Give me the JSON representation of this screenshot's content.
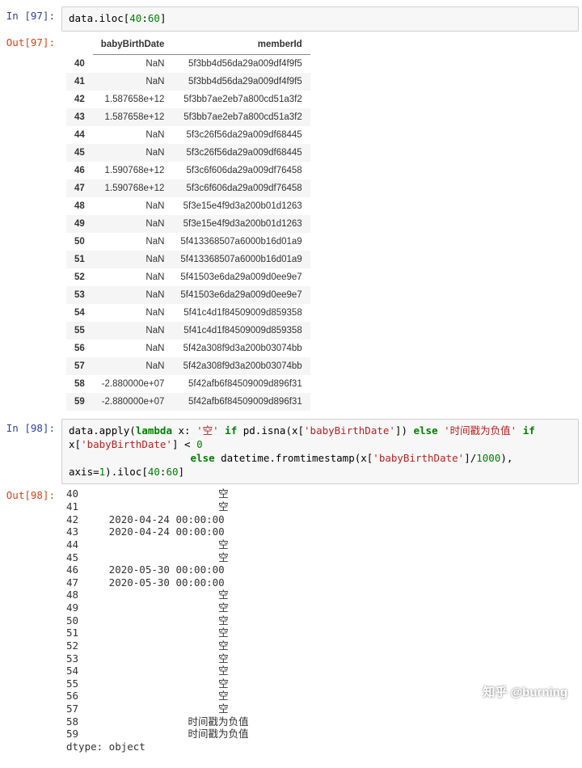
{
  "watermark": "知乎 @burning",
  "cell97": {
    "prompt_in": "In  [97]:",
    "prompt_out": "Out[97]:",
    "code": {
      "obj": "data",
      "method": "iloc",
      "slice": "[40:60]"
    },
    "df": {
      "columns": [
        "babyBirthDate",
        "memberId"
      ],
      "rows": [
        {
          "idx": "40",
          "babyBirthDate": "NaN",
          "memberId": "5f3bb4d56da29a009df4f9f5"
        },
        {
          "idx": "41",
          "babyBirthDate": "NaN",
          "memberId": "5f3bb4d56da29a009df4f9f5"
        },
        {
          "idx": "42",
          "babyBirthDate": "1.587658e+12",
          "memberId": "5f3bb7ae2eb7a800cd51a3f2"
        },
        {
          "idx": "43",
          "babyBirthDate": "1.587658e+12",
          "memberId": "5f3bb7ae2eb7a800cd51a3f2"
        },
        {
          "idx": "44",
          "babyBirthDate": "NaN",
          "memberId": "5f3c26f56da29a009df68445"
        },
        {
          "idx": "45",
          "babyBirthDate": "NaN",
          "memberId": "5f3c26f56da29a009df68445"
        },
        {
          "idx": "46",
          "babyBirthDate": "1.590768e+12",
          "memberId": "5f3c6f606da29a009df76458"
        },
        {
          "idx": "47",
          "babyBirthDate": "1.590768e+12",
          "memberId": "5f3c6f606da29a009df76458"
        },
        {
          "idx": "48",
          "babyBirthDate": "NaN",
          "memberId": "5f3e15e4f9d3a200b01d1263"
        },
        {
          "idx": "49",
          "babyBirthDate": "NaN",
          "memberId": "5f3e15e4f9d3a200b01d1263"
        },
        {
          "idx": "50",
          "babyBirthDate": "NaN",
          "memberId": "5f413368507a6000b16d01a9"
        },
        {
          "idx": "51",
          "babyBirthDate": "NaN",
          "memberId": "5f413368507a6000b16d01a9"
        },
        {
          "idx": "52",
          "babyBirthDate": "NaN",
          "memberId": "5f41503e6da29a009d0ee9e7"
        },
        {
          "idx": "53",
          "babyBirthDate": "NaN",
          "memberId": "5f41503e6da29a009d0ee9e7"
        },
        {
          "idx": "54",
          "babyBirthDate": "NaN",
          "memberId": "5f41c4d1f84509009d859358"
        },
        {
          "idx": "55",
          "babyBirthDate": "NaN",
          "memberId": "5f41c4d1f84509009d859358"
        },
        {
          "idx": "56",
          "babyBirthDate": "NaN",
          "memberId": "5f42a308f9d3a200b03074bb"
        },
        {
          "idx": "57",
          "babyBirthDate": "NaN",
          "memberId": "5f42a308f9d3a200b03074bb"
        },
        {
          "idx": "58",
          "babyBirthDate": "-2.880000e+07",
          "memberId": "5f42afb6f84509009d896f31"
        },
        {
          "idx": "59",
          "babyBirthDate": "-2.880000e+07",
          "memberId": "5f42afb6f84509009d896f31"
        }
      ]
    }
  },
  "cell98": {
    "prompt_in": "In  [98]:",
    "prompt_out": "Out[98]:",
    "code_tokens": [
      {
        "t": "data",
        "c": "tok-var"
      },
      {
        "t": ".",
        "c": "tok-punc"
      },
      {
        "t": "apply",
        "c": "tok-attr"
      },
      {
        "t": "(",
        "c": "tok-punc"
      },
      {
        "t": "lambda",
        "c": "tok-kw"
      },
      {
        "t": " x: ",
        "c": "tok-var"
      },
      {
        "t": "'空'",
        "c": "tok-str"
      },
      {
        "t": " ",
        "c": "tok-punc"
      },
      {
        "t": "if",
        "c": "tok-kw"
      },
      {
        "t": " pd.isna(x[",
        "c": "tok-var"
      },
      {
        "t": "'babyBirthDate'",
        "c": "tok-strid"
      },
      {
        "t": "]) ",
        "c": "tok-var"
      },
      {
        "t": "else",
        "c": "tok-kw"
      },
      {
        "t": " ",
        "c": "tok-punc"
      },
      {
        "t": "'时间戳为负值'",
        "c": "tok-str"
      },
      {
        "t": " ",
        "c": "tok-punc"
      },
      {
        "t": "if",
        "c": "tok-kw"
      },
      {
        "t": " x[",
        "c": "tok-var"
      },
      {
        "t": "'babyBirthDate'",
        "c": "tok-strid"
      },
      {
        "t": "] < ",
        "c": "tok-var"
      },
      {
        "t": "0",
        "c": "tok-num"
      },
      {
        "t": "\n",
        "c": ""
      },
      {
        "t": "                    ",
        "c": ""
      },
      {
        "t": "else",
        "c": "tok-kw"
      },
      {
        "t": " datetime.fromtimestamp(x[",
        "c": "tok-var"
      },
      {
        "t": "'babyBirthDate'",
        "c": "tok-strid"
      },
      {
        "t": "]/",
        "c": "tok-var"
      },
      {
        "t": "1000",
        "c": "tok-num"
      },
      {
        "t": "),  axis=",
        "c": "tok-var"
      },
      {
        "t": "1",
        "c": "tok-num"
      },
      {
        "t": ").iloc[",
        "c": "tok-var"
      },
      {
        "t": "40",
        "c": "tok-slice"
      },
      {
        "t": ":",
        "c": "tok-punc"
      },
      {
        "t": "60",
        "c": "tok-slice"
      },
      {
        "t": "]",
        "c": "tok-var"
      }
    ],
    "series": [
      {
        "idx": "40",
        "val": "空"
      },
      {
        "idx": "41",
        "val": "空"
      },
      {
        "idx": "42",
        "val": "2020-04-24 00:00:00"
      },
      {
        "idx": "43",
        "val": "2020-04-24 00:00:00"
      },
      {
        "idx": "44",
        "val": "空"
      },
      {
        "idx": "45",
        "val": "空"
      },
      {
        "idx": "46",
        "val": "2020-05-30 00:00:00"
      },
      {
        "idx": "47",
        "val": "2020-05-30 00:00:00"
      },
      {
        "idx": "48",
        "val": "空"
      },
      {
        "idx": "49",
        "val": "空"
      },
      {
        "idx": "50",
        "val": "空"
      },
      {
        "idx": "51",
        "val": "空"
      },
      {
        "idx": "52",
        "val": "空"
      },
      {
        "idx": "53",
        "val": "空"
      },
      {
        "idx": "54",
        "val": "空"
      },
      {
        "idx": "55",
        "val": "空"
      },
      {
        "idx": "56",
        "val": "空"
      },
      {
        "idx": "57",
        "val": "空"
      },
      {
        "idx": "58",
        "val": "时间戳为负值"
      },
      {
        "idx": "59",
        "val": "时间戳为负值"
      }
    ],
    "dtype_line": "dtype: object",
    "value_col_width": 22
  }
}
